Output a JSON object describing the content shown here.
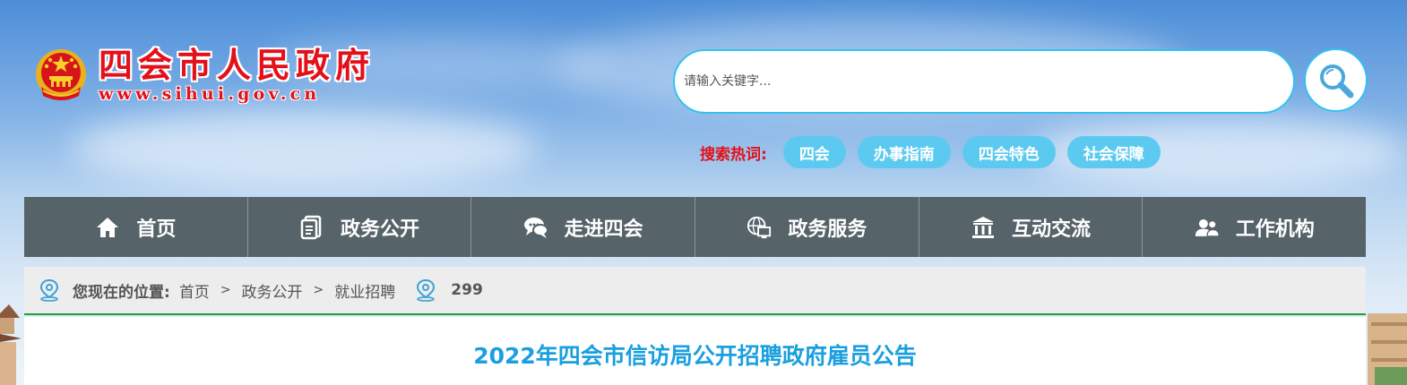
{
  "site": {
    "name_cn": "四会市人民政府",
    "domain": "www.sihui.gov.cn",
    "emblem_icon": "national-emblem-icon"
  },
  "search": {
    "placeholder": "请输入关键字...",
    "button_icon": "search-icon",
    "hot_label": "搜索热词:",
    "hot_words": [
      "四会",
      "办事指南",
      "四会特色",
      "社会保障"
    ]
  },
  "nav": {
    "items": [
      {
        "label": "首页",
        "icon": "home-icon"
      },
      {
        "label": "政务公开",
        "icon": "document-icon"
      },
      {
        "label": "走进四会",
        "icon": "chat-bubbles-icon"
      },
      {
        "label": "政务服务",
        "icon": "globe-computer-icon"
      },
      {
        "label": "互动交流",
        "icon": "building-columns-icon"
      },
      {
        "label": "工作机构",
        "icon": "users-icon"
      }
    ]
  },
  "breadcrumb": {
    "label": "您现在的位置:",
    "items": [
      "首页",
      "政务公开",
      "就业招聘"
    ],
    "separator": ">",
    "views": "299"
  },
  "article": {
    "title": "2022年四会市信访局公开招聘政府雇员公告"
  },
  "colors": {
    "brand_red": "#e3101a",
    "accent_blue": "#33c2f0",
    "tag_blue": "#5ccaf0",
    "nav_bg": "#566369",
    "title_blue": "#1a9fdf",
    "crumb_line": "#1d9e3e"
  }
}
